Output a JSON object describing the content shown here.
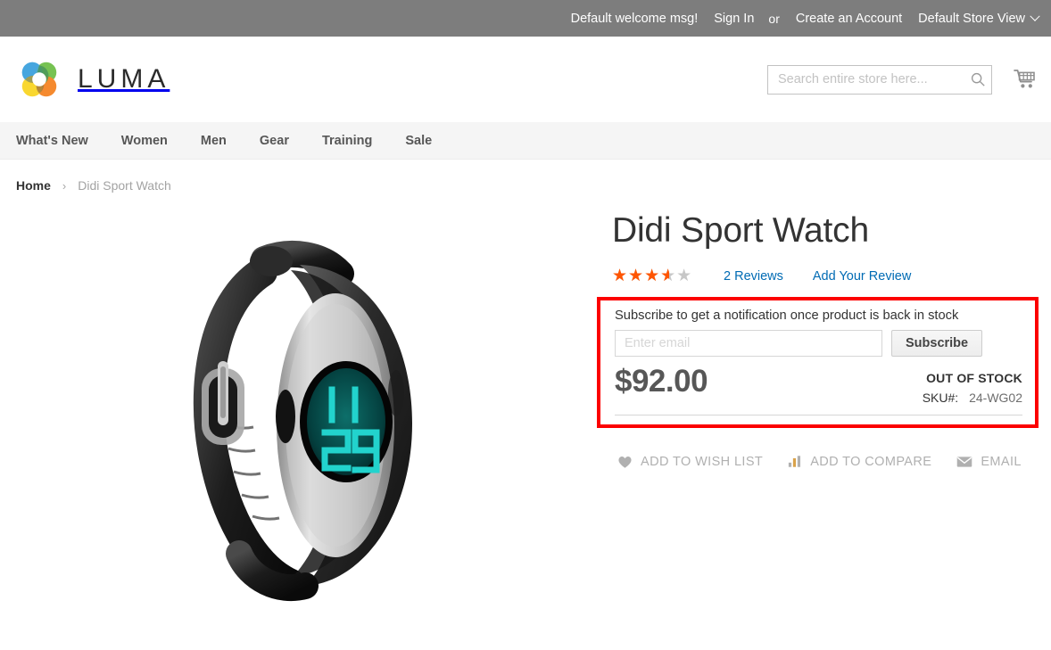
{
  "topbar": {
    "welcome_msg": "Default welcome msg!",
    "sign_in": "Sign In",
    "or": "or",
    "create_account": "Create an Account",
    "store_view": "Default Store View",
    "background_color": "#7d7d7d"
  },
  "header": {
    "logo_text": "LUMA",
    "logo_icon": "luma-flower-logo",
    "search": {
      "value": "",
      "placeholder": "Search entire store here...",
      "icon": "search-icon"
    },
    "cart_icon": "shopping-cart-icon"
  },
  "nav": {
    "items": [
      {
        "label": "What's New"
      },
      {
        "label": "Women"
      },
      {
        "label": "Men"
      },
      {
        "label": "Gear"
      },
      {
        "label": "Training"
      },
      {
        "label": "Sale"
      }
    ]
  },
  "breadcrumb": {
    "home": "Home",
    "separator": "›",
    "current": "Didi Sport Watch"
  },
  "product": {
    "title": "Didi Sport Watch",
    "image_alt": "Didi Sport Watch black band silver bezel digital display 11:49",
    "rating": {
      "value": 3.5,
      "max": 5,
      "percent": "70%",
      "filled_color": "#ff5501",
      "empty_color": "#c7c7c7",
      "reviews_link": "2 Reviews",
      "add_review_link": "Add Your Review"
    },
    "stock_panel": {
      "highlight_color": "#fc0000",
      "subscribe_label": "Subscribe to get a notification once product is back in stock",
      "email_value": "",
      "email_placeholder": "Enter email",
      "subscribe_button": "Subscribe",
      "price": "$92.00",
      "stock_status": "OUT OF STOCK",
      "sku_label": "SKU#:",
      "sku_value": "24-WG02"
    },
    "actions": [
      {
        "label": "ADD TO WISH LIST",
        "icon": "heart-icon"
      },
      {
        "label": "ADD TO COMPARE",
        "icon": "bar-chart-icon"
      },
      {
        "label": "EMAIL",
        "icon": "envelope-icon"
      }
    ]
  }
}
